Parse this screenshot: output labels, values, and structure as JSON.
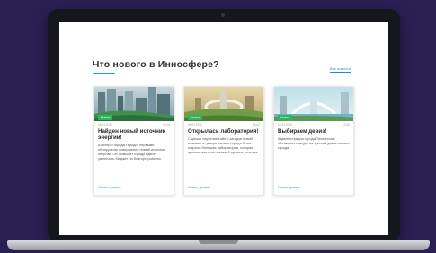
{
  "page": {
    "title": "Что нового в Инноcфере?",
    "all_news": "Все новости"
  },
  "cards": [
    {
      "badge": "Новое",
      "date": "06.03.2020",
      "time": "12:00",
      "heading": "Найден новый источник энергии!",
      "body": "Шахтеры города Геродот первыми обнаружили совершенно новый источник энергии. Он позволит городу вдвое увеличить бюджет на благоустройство.",
      "more": "Читать далее ›"
    },
    {
      "badge": "Новое",
      "date": "06.03.2020",
      "time": "12:00",
      "heading": "Открылась лаборатория!",
      "body": "С целью изучения тайн и загадок новой планеты в центре нашего города была открыта большая лаборатория, которая приглашает всех жителей принять участие",
      "more": "Читать далее ›"
    },
    {
      "badge": "Новое",
      "date": "06.03.2020",
      "time": "12:00",
      "heading": "Выбираем девиз!",
      "body": "Администрация города Технополис объявляет конкурс на лучший девиз нашего города",
      "more": "Читать далее ›"
    }
  ],
  "colors": {
    "background": "#2a1f52",
    "accent": "#1aa6d6",
    "badge": "#2fb562",
    "link": "#1a8fd8"
  }
}
